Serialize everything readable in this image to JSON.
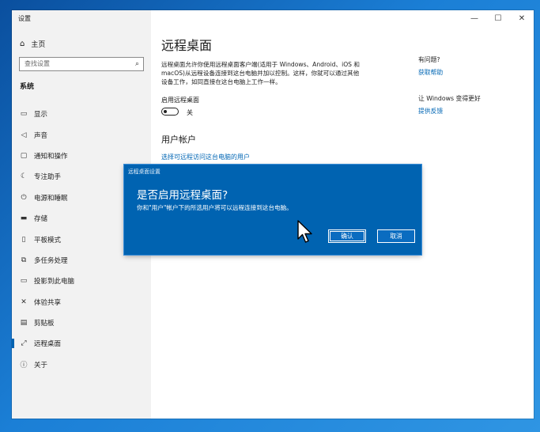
{
  "window": {
    "title": "设置",
    "controls": {
      "minimize": "—",
      "maximize": "☐",
      "close": "✕"
    }
  },
  "sidebar": {
    "home": "主页",
    "search_placeholder": "查找设置",
    "section": "系统",
    "items": [
      {
        "label": "显示",
        "icon": "display-icon"
      },
      {
        "label": "声音",
        "icon": "sound-icon"
      },
      {
        "label": "通知和操作",
        "icon": "notifications-icon"
      },
      {
        "label": "专注助手",
        "icon": "focus-assist-icon"
      },
      {
        "label": "电源和睡眠",
        "icon": "power-icon"
      },
      {
        "label": "存储",
        "icon": "storage-icon"
      },
      {
        "label": "平板模式",
        "icon": "tablet-mode-icon"
      },
      {
        "label": "多任务处理",
        "icon": "multitasking-icon"
      },
      {
        "label": "投影到此电脑",
        "icon": "projecting-icon"
      },
      {
        "label": "体验共享",
        "icon": "shared-experiences-icon"
      },
      {
        "label": "剪贴板",
        "icon": "clipboard-icon"
      },
      {
        "label": "远程桌面",
        "icon": "remote-desktop-icon",
        "active": true
      },
      {
        "label": "关于",
        "icon": "about-icon"
      }
    ]
  },
  "main": {
    "title": "远程桌面",
    "description": "远程桌面允许你使用远程桌面客户端(适用于 Windows、Android、iOS 和 macOS)从远程设备连接到这台电脑并加以控制。这样，你就可以通过其他设备工作，如同直接在这台电脑上工作一样。",
    "toggle_label": "启用远程桌面",
    "toggle_state": "关",
    "user_accounts_heading": "用户帐户",
    "user_accounts_link": "选择可远程访问这台电脑的用户"
  },
  "right_panel": {
    "question": "有问题?",
    "help_link": "获取帮助",
    "improve": "让 Windows 变得更好",
    "feedback_link": "提供反馈"
  },
  "dialog": {
    "title": "远程桌面设置",
    "heading": "是否启用远程桌面?",
    "message": "你和\"用户\"帐户下的所选用户将可以远程连接到这台电脑。",
    "confirm": "确认",
    "cancel": "取消"
  },
  "colors": {
    "accent": "#0063b1",
    "link": "#0066b4",
    "sidebar_bg": "#f2f2f2"
  }
}
